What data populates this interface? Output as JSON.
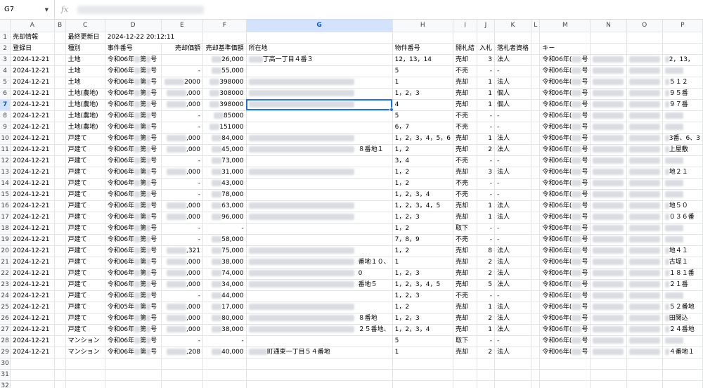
{
  "name_box": "G7",
  "fx_label": "fx",
  "columns": [
    "A",
    "B",
    "C",
    "D",
    "E",
    "F",
    "G",
    "H",
    "I",
    "J",
    "K",
    "L",
    "M",
    "N",
    "O",
    "P"
  ],
  "selected": {
    "col": "G",
    "row": 7
  },
  "row1": {
    "a": "売却情報",
    "c": "最終更新日",
    "d": "2024-12-22 20:12:11"
  },
  "headers": [
    "登録日",
    "",
    "種別",
    "事件番号",
    "売却価額",
    "売却基準価額",
    "所在地",
    "物件番号",
    "開札結",
    "入札",
    "落札者資格",
    "",
    "キー",
    "",
    "",
    ""
  ],
  "rows": [
    {
      "a": "2024-12-21",
      "c": "土地",
      "d": "令和06年",
      "d2": "第",
      "d3": "号",
      "e": "",
      "f": "26,000",
      "g": "丁高一丁目４番３",
      "h": "12，13，14",
      "i": "売却",
      "j": "3",
      "k": "法人",
      "m": "令和06年(",
      "m2": "号",
      "p": "2，13，"
    },
    {
      "a": "2024-12-21",
      "c": "土地",
      "d": "令和06年",
      "d2": "第",
      "d3": "号",
      "e": "-",
      "f": "55,000",
      "g": "",
      "h": "5",
      "i": "不売",
      "j": "-",
      "k": "-",
      "m": "令和06年(",
      "m2": "号",
      "p": ""
    },
    {
      "a": "2024-12-21",
      "c": "土地",
      "d": "令和06年",
      "d2": "第",
      "d3": "号",
      "e": "2000",
      "f": "398000",
      "g": "",
      "h": "1",
      "i": "売却",
      "j": "1",
      "k": "法人",
      "m": "令和06年(",
      "m2": "号",
      "p": "５１２"
    },
    {
      "a": "2024-12-21",
      "c": "土地(農地)",
      "d": "令和06年",
      "d2": "第",
      "d3": "号",
      "e": ",000",
      "f": "308000",
      "g": "",
      "h": "1，2，3",
      "i": "売却",
      "j": "1",
      "k": "個人",
      "m": "令和06年(",
      "m2": "号",
      "p": "９５番"
    },
    {
      "a": "2024-12-21",
      "c": "土地(農地)",
      "d": "令和06年",
      "d2": "第",
      "d3": "号",
      "e": ",000",
      "f": "398000",
      "g": "",
      "h": "4",
      "i": "売却",
      "j": "1",
      "k": "個人",
      "m": "令和06年(",
      "m2": "号",
      "p": "９７番"
    },
    {
      "a": "2024-12-21",
      "c": "土地(農地)",
      "d": "令和06年",
      "d2": "第",
      "d3": "号",
      "e": "-",
      "f": "85000",
      "g": "",
      "h": "5",
      "i": "不売",
      "j": "-",
      "k": "-",
      "m": "令和06年(",
      "m2": "号",
      "p": ""
    },
    {
      "a": "2024-12-21",
      "c": "土地(農地)",
      "d": "令和06年",
      "d2": "第",
      "d3": "号",
      "e": "-",
      "f": "151000",
      "g": "",
      "h": "6，7",
      "i": "不売",
      "j": "-",
      "k": "-",
      "m": "令和06年(",
      "m2": "号",
      "p": ""
    },
    {
      "a": "2024-12-21",
      "c": "戸建て",
      "d": "令和06年",
      "d2": "第",
      "d3": "号",
      "e": ",000",
      "f": "84,000",
      "g": "",
      "h": "1，2，3，4，5，6",
      "i": "売却",
      "j": "1",
      "k": "法人",
      "m": "令和06年(",
      "m2": "号",
      "p": "3番、6、3"
    },
    {
      "a": "2024-12-21",
      "c": "戸建て",
      "d": "令和06年",
      "d2": "第",
      "d3": "号",
      "e": ",000",
      "f": "45,000",
      "g": "８番地１",
      "h": "1，2",
      "i": "売却",
      "j": "2",
      "k": "法人",
      "m": "令和06年(",
      "m2": "号",
      "p": "上屋敷"
    },
    {
      "a": "2024-12-21",
      "c": "戸建て",
      "d": "令和06年",
      "d2": "第",
      "d3": "号",
      "e": "-",
      "f": "73,000",
      "g": "",
      "h": "3，4",
      "i": "不売",
      "j": "-",
      "k": "-",
      "m": "令和06年(",
      "m2": "号",
      "p": ""
    },
    {
      "a": "2024-12-21",
      "c": "戸建て",
      "d": "令和06年",
      "d2": "第",
      "d3": "号",
      "e": ",000",
      "f": "31,000",
      "g": "",
      "h": "1，2",
      "i": "売却",
      "j": "3",
      "k": "法人",
      "m": "令和06年(",
      "m2": "号",
      "p": "地２１"
    },
    {
      "a": "2024-12-21",
      "c": "戸建て",
      "d": "令和06年",
      "d2": "第",
      "d3": "号",
      "e": "-",
      "f": "43,000",
      "g": "",
      "h": "1，2",
      "i": "不売",
      "j": "-",
      "k": "-",
      "m": "令和06年(",
      "m2": "号",
      "p": ""
    },
    {
      "a": "2024-12-21",
      "c": "戸建て",
      "d": "令和06年",
      "d2": "第",
      "d3": "号",
      "e": "-",
      "f": "78,000",
      "g": "",
      "h": "1，2，3，4",
      "i": "不売",
      "j": "-",
      "k": "-",
      "m": "令和06年(",
      "m2": "号",
      "p": ""
    },
    {
      "a": "2024-12-21",
      "c": "戸建て",
      "d": "令和06年",
      "d2": "第",
      "d3": "号",
      "e": ",000",
      "f": "63,000",
      "g": "",
      "h": "1，2，3，4，5",
      "i": "売却",
      "j": "1",
      "k": "法人",
      "m": "令和06年(",
      "m2": "号",
      "p": "地５０"
    },
    {
      "a": "2024-12-21",
      "c": "戸建て",
      "d": "令和06年",
      "d2": "第",
      "d3": "号",
      "e": ",000",
      "f": "96,000",
      "g": "",
      "h": "1，2，3",
      "i": "売却",
      "j": "1",
      "k": "法人",
      "m": "令和06年(",
      "m2": "号",
      "p": "０３６番"
    },
    {
      "a": "2024-12-21",
      "c": "戸建て",
      "d": "令和06年",
      "d2": "第",
      "d3": "号",
      "e": "-",
      "f": "-",
      "g": "",
      "h": "1，2",
      "i": "取下",
      "j": "-",
      "k": "-",
      "m": "令和06年(",
      "m2": "号",
      "p": ""
    },
    {
      "a": "2024-12-21",
      "c": "戸建て",
      "d": "令和06年",
      "d2": "第",
      "d3": "号",
      "e": "-",
      "f": "58,000",
      "g": "",
      "h": "7，8，9",
      "i": "不売",
      "j": "-",
      "k": "-",
      "m": "令和06年(",
      "m2": "号",
      "p": ""
    },
    {
      "a": "2024-12-21",
      "c": "戸建て",
      "d": "令和06年",
      "d2": "第",
      "d3": "号",
      "e": ",321",
      "f": "75,000",
      "g": "",
      "h": "1，2",
      "i": "売却",
      "j": "8",
      "k": "法人",
      "m": "令和06年(",
      "m2": "号",
      "p": "地４１"
    },
    {
      "a": "2024-12-21",
      "c": "戸建て",
      "d": "令和06年",
      "d2": "第",
      "d3": "号",
      "e": ",000",
      "f": "38,000",
      "g": "番地１０、",
      "h": "1",
      "i": "売却",
      "j": "2",
      "k": "法人",
      "m": "令和06年(",
      "m2": "号",
      "p": "古堤１"
    },
    {
      "a": "2024-12-21",
      "c": "戸建て",
      "d": "令和06年",
      "d2": "第",
      "d3": "号",
      "e": ",000",
      "f": "74,000",
      "g": "0",
      "h": "1，2，3",
      "i": "売却",
      "j": "2",
      "k": "法人",
      "m": "令和06年(",
      "m2": "号",
      "p": "１８１番"
    },
    {
      "a": "2024-12-21",
      "c": "戸建て",
      "d": "令和06年",
      "d2": "第",
      "d3": "号",
      "e": ",000",
      "f": "34,000",
      "g": "番地５",
      "h": "1，2，3，4，5",
      "i": "売却",
      "j": "5",
      "k": "法人",
      "m": "令和06年(",
      "m2": "号",
      "p": "２１番"
    },
    {
      "a": "2024-12-21",
      "c": "戸建て",
      "d": "令和06年",
      "d2": "第",
      "d3": "号",
      "e": "-",
      "f": "44,000",
      "g": "",
      "h": "1，2，3",
      "i": "不売",
      "j": "-",
      "k": "-",
      "m": "令和06年(",
      "m2": "号",
      "p": ""
    },
    {
      "a": "2024-12-21",
      "c": "戸建て",
      "d": "令和05年",
      "d2": "第",
      "d3": "号",
      "e": ",000",
      "f": "17,000",
      "g": "",
      "h": "1，2",
      "i": "売却",
      "j": "1",
      "k": "法人",
      "m": "令和06年(",
      "m2": "号",
      "p": "５２番地"
    },
    {
      "a": "2024-12-21",
      "c": "戸建て",
      "d": "令和06年",
      "d2": "第",
      "d3": "号",
      "e": ",000",
      "f": "80,000",
      "g": "８番地",
      "h": "1，2，3",
      "i": "売却",
      "j": "2",
      "k": "法人",
      "m": "令和06年(",
      "m2": "号",
      "p": "田関込"
    },
    {
      "a": "2024-12-21",
      "c": "戸建て",
      "d": "令和06年",
      "d2": "第",
      "d3": "号",
      "e": ",000",
      "f": "38,000",
      "g": "２５番地、",
      "h": "1，2，3，4",
      "i": "売却",
      "j": "1",
      "k": "法人",
      "m": "令和06年(",
      "m2": "号",
      "p": "２４番地"
    },
    {
      "a": "2024-12-21",
      "c": "マンション",
      "d": "令和06年",
      "d2": "第",
      "d3": "号",
      "e": "-",
      "f": "-",
      "g": "",
      "h": "5",
      "i": "取下",
      "j": "-",
      "k": "-",
      "m": "令和06年(",
      "m2": "号",
      "p": ""
    },
    {
      "a": "2024-12-21",
      "c": "マンション",
      "d": "令和06年",
      "d2": "第",
      "d3": "号",
      "e": ",208",
      "f": "40,000",
      "g": "町通東一丁目５４番地",
      "h": "1",
      "i": "売却",
      "j": "2",
      "k": "法人",
      "m": "令和06年(",
      "m2": "号",
      "p": "４番地１"
    }
  ],
  "empty_rows": [
    30,
    31,
    32
  ]
}
